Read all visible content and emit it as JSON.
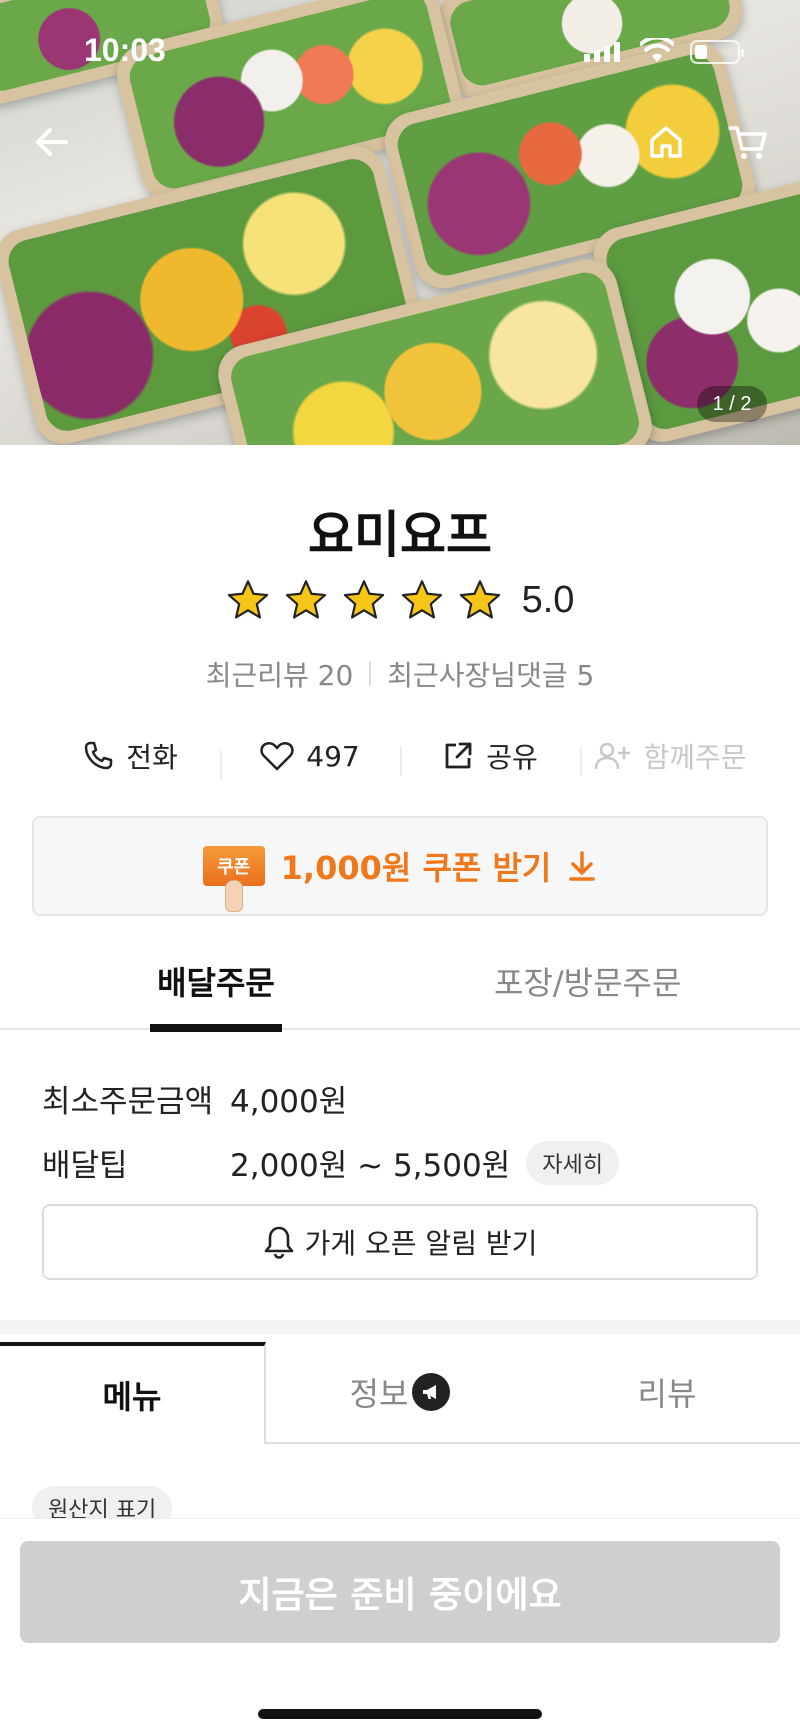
{
  "status_bar": {
    "time": "10:03"
  },
  "hero": {
    "page_indicator": "1 / 2"
  },
  "icons": {
    "back": "back-arrow-icon",
    "home": "home-icon",
    "cart": "cart-icon"
  },
  "store": {
    "name": "요미요프",
    "rating": "5.0",
    "stars_filled": 5,
    "stars_total": 5,
    "recent_reviews": "최근리뷰 20",
    "owner_replies": "최근사장님댓글 5"
  },
  "actions": {
    "call": "전화",
    "like_count": "497",
    "share": "공유",
    "group_order": "함께주문"
  },
  "coupon": {
    "tag": "쿠폰",
    "label": "1,000원 쿠폰 받기"
  },
  "order_tabs": {
    "delivery": "배달주문",
    "pickup": "포장/방문주문"
  },
  "delivery_info": {
    "min_order_label": "최소주문금액",
    "min_order_value": "4,000원",
    "tip_label": "배달팁",
    "tip_value": "2,000원 ~ 5,500원",
    "detail": "자세히"
  },
  "alarm_button": "가게 오픈 알림 받기",
  "main_tabs": {
    "menu": "메뉴",
    "info": "정보",
    "review": "리뷰"
  },
  "origin_label": "원산지 표기",
  "cta": "지금은 준비 중이에요",
  "colors": {
    "accent": "#f0781c",
    "star": "#f5c518",
    "cta_disabled": "#cfcfcf"
  }
}
